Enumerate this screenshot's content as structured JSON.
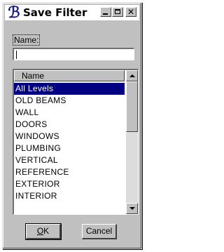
{
  "window": {
    "title": "Save Filter",
    "icon": "bentley-b-icon"
  },
  "name_field": {
    "label": "Name:",
    "value": ""
  },
  "list": {
    "header": "Name",
    "items": [
      "All Levels",
      "OLD BEAMS",
      "WALL",
      "DOORS",
      "WINDOWS",
      "PLUMBING",
      "VERTICAL",
      "REFERENCE",
      "EXTERIOR",
      "INTERIOR"
    ],
    "selected_index": 0
  },
  "buttons": {
    "ok_mnemonic": "O",
    "ok_rest": "K",
    "cancel": "Cancel"
  }
}
